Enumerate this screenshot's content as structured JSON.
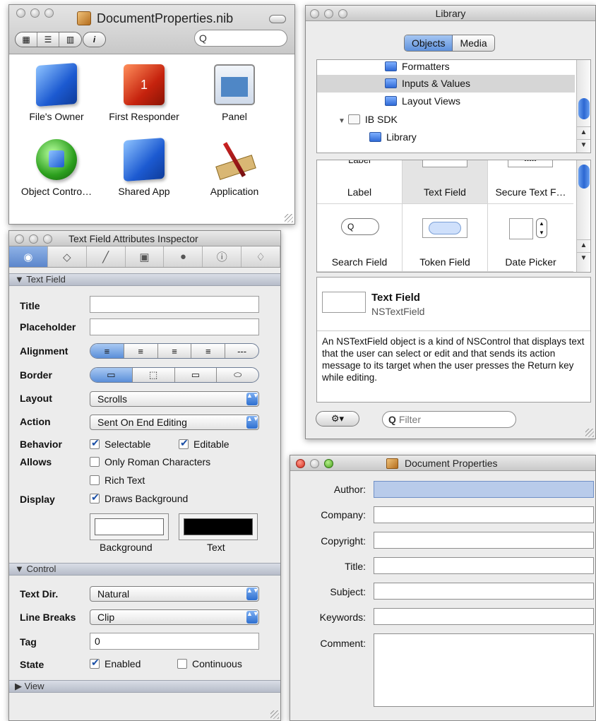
{
  "nib": {
    "title": "DocumentProperties.nib",
    "search_icon": "Q",
    "view_buttons": [
      "▦",
      "☰",
      "▥"
    ],
    "info_button": "i",
    "objects": [
      {
        "label": "File's Owner",
        "icon": "blue-cube-icon"
      },
      {
        "label": "First Responder",
        "icon": "red-cube-icon",
        "glyph": "1"
      },
      {
        "label": "Panel",
        "icon": "panel-icon"
      },
      {
        "label": "Object Contro…",
        "icon": "object-controller-icon"
      },
      {
        "label": "Shared App",
        "icon": "blue-cube-icon"
      },
      {
        "label": "Application",
        "icon": "application-icon"
      }
    ]
  },
  "inspector": {
    "title": "Text Field Attributes Inspector",
    "tool_icons": [
      "◉",
      "◇",
      "╱",
      "▣",
      "●",
      "ⓘ",
      "♢"
    ],
    "section_text_field": "▼ Text Field",
    "labels": {
      "title": "Title",
      "placeholder": "Placeholder",
      "alignment": "Alignment",
      "border": "Border",
      "layout": "Layout",
      "action": "Action",
      "behavior": "Behavior",
      "allows": "Allows",
      "display": "Display"
    },
    "title_value": "",
    "placeholder_value": "",
    "alignment_options": [
      "≡",
      "≡",
      "≡",
      "≡",
      "---"
    ],
    "border_options": [
      "▭",
      "⬚",
      "▭",
      "⬭"
    ],
    "layout_value": "Scrolls",
    "action_value": "Sent On End Editing",
    "selectable": "Selectable",
    "editable": "Editable",
    "only_roman": "Only Roman Characters",
    "rich_text": "Rich Text",
    "draws_background": "Draws Background",
    "background_label": "Background",
    "text_label": "Text",
    "colors": {
      "background": "#ffffff",
      "text": "#000000"
    },
    "section_control": "▼ Control",
    "text_dir_label": "Text Dir.",
    "text_dir_value": "Natural",
    "line_breaks_label": "Line Breaks",
    "line_breaks_value": "Clip",
    "tag_label": "Tag",
    "tag_value": "0",
    "state_label": "State",
    "enabled": "Enabled",
    "continuous": "Continuous",
    "section_view": "▶ View",
    "popup_arrow": "▲▼"
  },
  "library": {
    "title": "Library",
    "tabs": [
      "Objects",
      "Media"
    ],
    "tree": [
      {
        "label": "Formatters"
      },
      {
        "label": "Inputs & Values"
      },
      {
        "label": "Layout Views"
      },
      {
        "label": "IB SDK"
      },
      {
        "label": "Library"
      }
    ],
    "grid": [
      {
        "label": "Label"
      },
      {
        "label": "Text Field"
      },
      {
        "label": "Secure Text F…"
      },
      {
        "label": "Search Field"
      },
      {
        "label": "Token Field"
      },
      {
        "label": "Date Picker"
      }
    ],
    "label_preview": "Label",
    "secure_preview": "•••••",
    "search_preview_icon": "Q",
    "selected_name": "Text Field",
    "selected_class": "NSTextField",
    "description": "An NSTextField object is a kind of NSControl that displays text that the user can select or edit and that sends its action message to its target when the user presses the Return key while editing.",
    "gear_label": "⚙▾",
    "filter_placeholder": "Filter",
    "filter_icon": "Q"
  },
  "doc_props": {
    "title": "Document Properties",
    "fields": [
      {
        "label": "Author:"
      },
      {
        "label": "Company:"
      },
      {
        "label": "Copyright:"
      },
      {
        "label": "Title:"
      },
      {
        "label": "Subject:"
      },
      {
        "label": "Keywords:"
      },
      {
        "label": "Comment:"
      }
    ]
  }
}
